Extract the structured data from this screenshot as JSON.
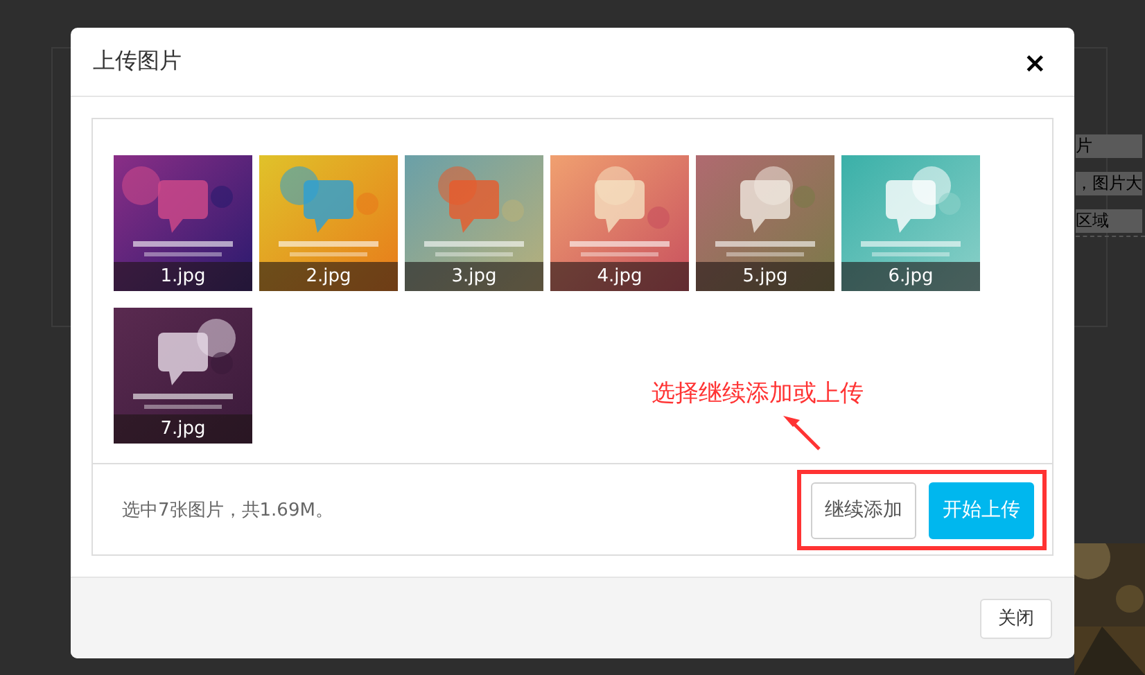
{
  "background": {
    "texts": [
      "片",
      "，图片大",
      "区域"
    ]
  },
  "dialog": {
    "title": "上传图片",
    "close": "×"
  },
  "thumbnails": [
    {
      "caption": "1.jpg"
    },
    {
      "caption": "2.jpg"
    },
    {
      "caption": "3.jpg"
    },
    {
      "caption": "4.jpg"
    },
    {
      "caption": "5.jpg"
    },
    {
      "caption": "6.jpg"
    },
    {
      "caption": "7.jpg"
    }
  ],
  "annotation": "选择继续添加或上传",
  "summary": "选中7张图片，共1.69M。",
  "buttons": [
    {
      "label": "继续添加",
      "kind": "secondary"
    },
    {
      "label": "开始上传",
      "kind": "primary"
    }
  ],
  "footer_button": "关闭"
}
